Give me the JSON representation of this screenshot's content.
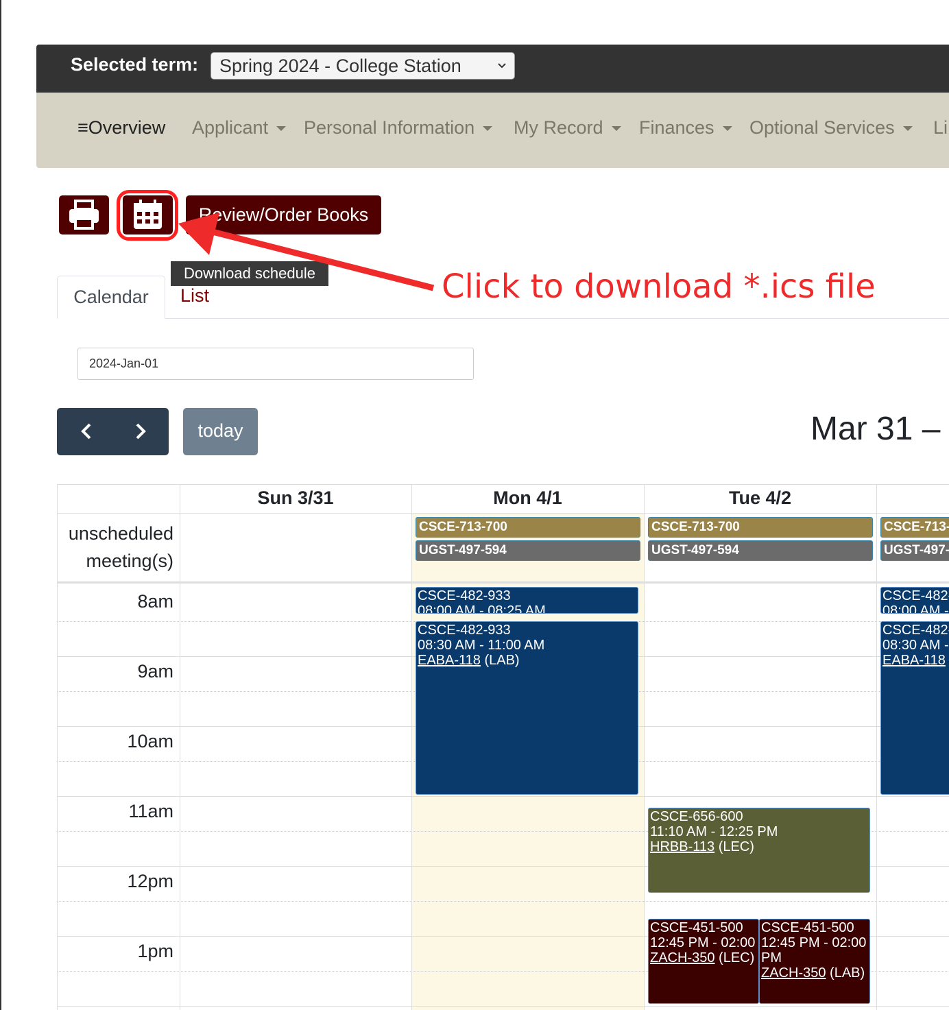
{
  "term": {
    "label": "Selected term:",
    "selected": "Spring 2024 - College Station"
  },
  "nav": {
    "overview": "Overview",
    "items": [
      "Applicant",
      "Personal Information",
      "My Record",
      "Finances",
      "Optional Services",
      "Li"
    ]
  },
  "toolbar": {
    "print_icon": "printer-icon",
    "calendar_icon": "calendar-icon",
    "books_label": "Review/Order Books",
    "tooltip": "Download schedule"
  },
  "annotation": "Click to download *.ics file",
  "tabs": {
    "calendar": "Calendar",
    "list": "List"
  },
  "date_input": "2024-Jan-01",
  "calendar_nav": {
    "prev": "‹",
    "next": "›",
    "today": "today",
    "range_title": "Mar 31 –"
  },
  "grid": {
    "days": [
      "Sun 3/31",
      "Mon 4/1",
      "Tue 4/2"
    ],
    "allday_label": "unscheduled meeting(s)",
    "times": [
      "8am",
      "9am",
      "10am",
      "11am",
      "12pm",
      "1pm"
    ],
    "allday_events": {
      "mon": [
        "CSCE-713-700",
        "UGST-497-594"
      ],
      "tue": [
        "CSCE-713-700",
        "UGST-497-594"
      ],
      "wed": [
        "CSCE-713-",
        "UGST-497-"
      ]
    },
    "events": {
      "mon1": {
        "title": "CSCE-482-933",
        "time": "08:00 AM - 08:25 AM"
      },
      "mon2": {
        "title": "CSCE-482-933",
        "time": "08:30 AM - 11:00 AM",
        "room": "EABA-118",
        "type": "(LAB)"
      },
      "tue1": {
        "title": "CSCE-656-600",
        "time": "11:10 AM - 12:25 PM",
        "room": "HRBB-113",
        "type": "(LEC)"
      },
      "tue2": {
        "title": "CSCE-451-500",
        "time": "12:45 PM - 02:00",
        "room": "ZACH-350",
        "type": "(LEC)"
      },
      "tue3": {
        "title": "CSCE-451-500",
        "time": "12:45 PM - 02:00",
        "time2": "PM",
        "room": "ZACH-350",
        "type": "(LAB)"
      },
      "wed1": {
        "title": "CSCE-482-",
        "time": "08:00 AM -"
      },
      "wed2": {
        "title": "CSCE-482-",
        "time": "08:30 AM -",
        "room": "EABA-118",
        "type": "("
      }
    }
  },
  "colors": {
    "maroon": "#500000",
    "navy": "#0a3a6b",
    "olive": "#5a5f36",
    "annotation": "#ef2a2a"
  }
}
